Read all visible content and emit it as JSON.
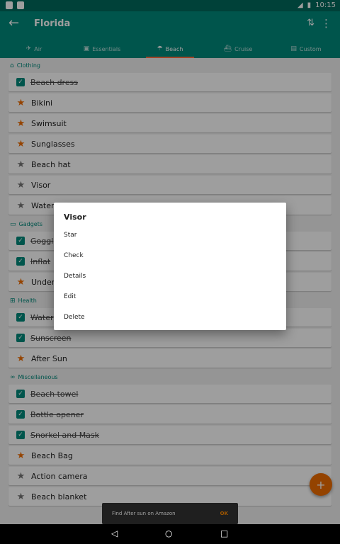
{
  "status_bar": {
    "time": "10:15"
  },
  "toolbar": {
    "title": "Florida",
    "back_icon": "arrow-back-icon",
    "sort_icon": "sort-icon",
    "more_icon": "more-vert-icon"
  },
  "tabs": [
    {
      "label": "Air",
      "icon": "plane-icon",
      "active": false
    },
    {
      "label": "Essentials",
      "icon": "suitcase-icon",
      "active": false
    },
    {
      "label": "Beach",
      "icon": "umbrella-icon",
      "active": true
    },
    {
      "label": "Cruise",
      "icon": "ship-icon",
      "active": false
    },
    {
      "label": "Custom",
      "icon": "bag-icon",
      "active": false
    }
  ],
  "sections": [
    {
      "name": "Clothing",
      "items": [
        {
          "label": "Beach dress",
          "state": "checked"
        },
        {
          "label": "Bikini",
          "state": "starred"
        },
        {
          "label": "Swimsuit",
          "state": "starred"
        },
        {
          "label": "Sunglasses",
          "state": "starred"
        },
        {
          "label": "Beach hat",
          "state": "unstarred"
        },
        {
          "label": "Visor",
          "state": "unstarred"
        },
        {
          "label": "Water",
          "state": "unstarred"
        }
      ]
    },
    {
      "name": "Gadgets",
      "items": [
        {
          "label": "Goggl",
          "state": "checked"
        },
        {
          "label": "Inflat",
          "state": "checked"
        },
        {
          "label": "Under",
          "state": "starred"
        }
      ]
    },
    {
      "name": "Health",
      "items": [
        {
          "label": "Water",
          "state": "checked"
        },
        {
          "label": "Sunscreen",
          "state": "checked"
        },
        {
          "label": "After Sun",
          "state": "starred"
        }
      ]
    },
    {
      "name": "Miscellaneous",
      "items": [
        {
          "label": "Beach towel",
          "state": "checked"
        },
        {
          "label": "Bottle opener",
          "state": "checked"
        },
        {
          "label": "Snorkel and Mask",
          "state": "checked"
        },
        {
          "label": "Beach Bag",
          "state": "starred"
        },
        {
          "label": "Action camera",
          "state": "unstarred"
        },
        {
          "label": "Beach blanket",
          "state": "unstarred"
        }
      ]
    }
  ],
  "dialog": {
    "title": "Visor",
    "options": [
      "Star",
      "Check",
      "Details",
      "Edit",
      "Delete"
    ]
  },
  "snackbar": {
    "message": "Find After sun on Amazon",
    "action": "OK"
  },
  "fab": {
    "label": "+"
  },
  "colors": {
    "primary": "#00897b",
    "primary_dark": "#00695c",
    "accent": "#ef6c00",
    "indicator": "#ff7043"
  }
}
